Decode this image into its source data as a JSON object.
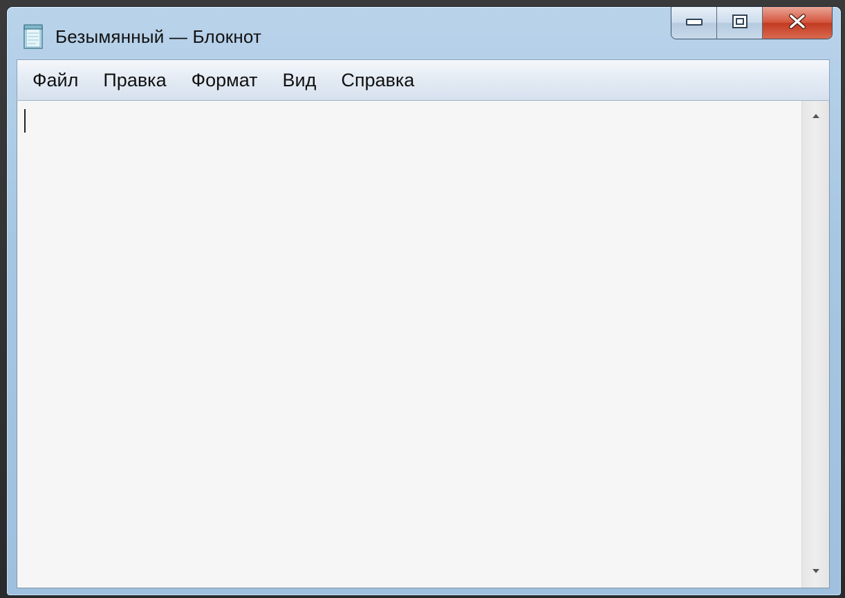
{
  "window": {
    "title": "Безымянный — Блокнот",
    "app_icon": "notepad-icon",
    "caption_buttons": [
      "minimize-icon",
      "maximize-icon",
      "close-icon"
    ]
  },
  "menu": {
    "items": [
      {
        "label": "Файл"
      },
      {
        "label": "Правка"
      },
      {
        "label": "Формат"
      },
      {
        "label": "Вид"
      },
      {
        "label": "Справка"
      }
    ]
  },
  "editor": {
    "content": ""
  },
  "colors": {
    "title_bar": "#a6c6e2",
    "close_button": "#c23a22",
    "editor_background": "#f6f6f6"
  }
}
